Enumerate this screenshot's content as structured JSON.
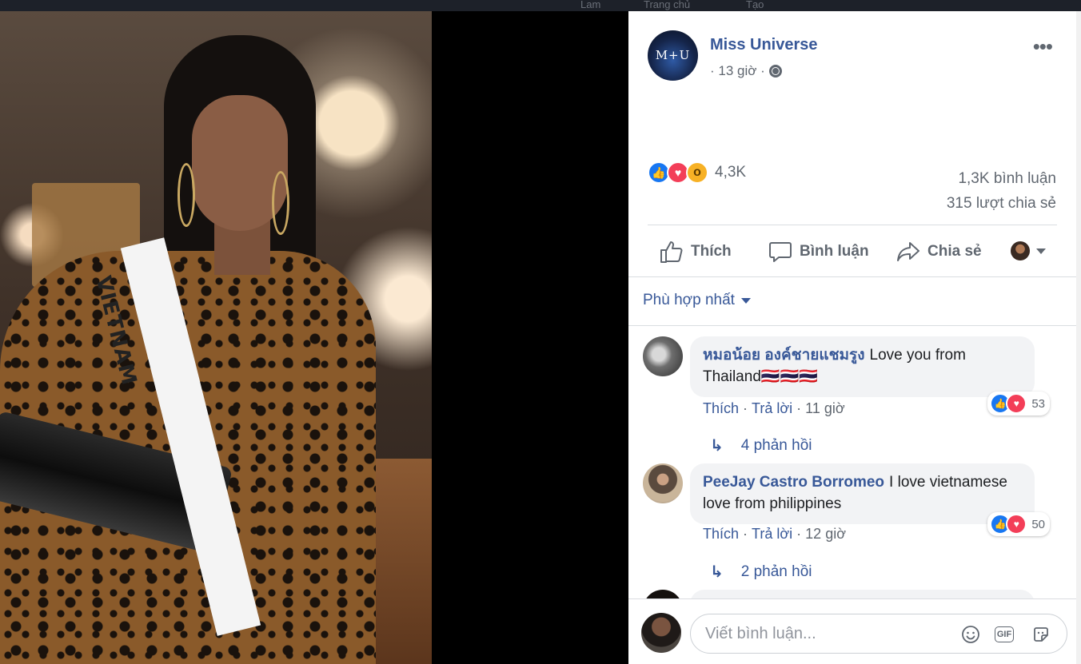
{
  "topbar": {
    "nav": [
      "Lam",
      "Trang chủ",
      "Tạo"
    ]
  },
  "photo": {
    "sash_text": "VIETNAM"
  },
  "post": {
    "page_name": "Miss Universe",
    "page_logo_text": "M+U",
    "time": "· 13 giờ ·",
    "reaction_count": "4,3K",
    "comments_count": "1,3K bình luận",
    "shares_count": "315 lượt chia sẻ"
  },
  "actions": {
    "like": "Thích",
    "comment": "Bình luận",
    "share": "Chia sẻ"
  },
  "sort": {
    "label": "Phù hợp nhất"
  },
  "comments": [
    {
      "author": "หมอน้อย องค์ชายแชมรูง",
      "text": "Love you from Thailand🇹🇭🇹🇭🇹🇭",
      "reactions": "53",
      "like": "Thích",
      "reply": "Trả lời",
      "time": "11 giờ",
      "replies": "4 phản hồi"
    },
    {
      "author": "PeeJay Castro Borromeo",
      "text": "I love vietnamese love from philippines",
      "reactions": "50",
      "like": "Thích",
      "reply": "Trả lời",
      "time": "12 giờ",
      "replies": "2 phản hồi"
    }
  ],
  "composer": {
    "placeholder": "Viết bình luận...",
    "gif_label": "GIF"
  },
  "colors": {
    "link": "#385898",
    "muted": "#606770",
    "like": "#1877f2",
    "love": "#f33e58",
    "wow": "#f7b125"
  },
  "icons": [
    "more-icon",
    "globe-icon",
    "like-icon",
    "comment-icon",
    "share-icon",
    "caret-down-icon",
    "reply-arrow-icon",
    "emoji-icon",
    "gif-icon",
    "sticker-icon"
  ]
}
